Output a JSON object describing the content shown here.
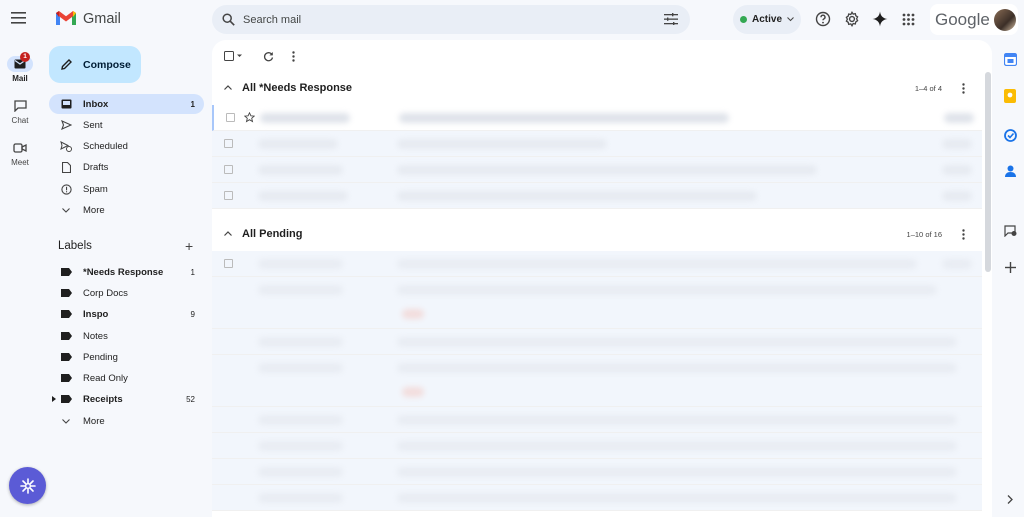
{
  "app": {
    "name": "Gmail"
  },
  "rail": {
    "items": [
      {
        "label": "Mail",
        "badge": "1"
      },
      {
        "label": "Chat"
      },
      {
        "label": "Meet"
      }
    ]
  },
  "search": {
    "placeholder": "Search mail"
  },
  "status": {
    "label": "Active",
    "color": "#34a853"
  },
  "account": {
    "brand": "Google"
  },
  "compose": {
    "label": "Compose"
  },
  "nav": {
    "items": [
      {
        "label": "Inbox",
        "count": "1"
      },
      {
        "label": "Sent",
        "count": ""
      },
      {
        "label": "Scheduled",
        "count": ""
      },
      {
        "label": "Drafts",
        "count": ""
      },
      {
        "label": "Spam",
        "count": ""
      },
      {
        "label": "More",
        "count": ""
      }
    ]
  },
  "labels": {
    "title": "Labels",
    "items": [
      {
        "label": "*Needs Response",
        "count": "1"
      },
      {
        "label": "Corp Docs",
        "count": ""
      },
      {
        "label": "Inspo",
        "count": "9"
      },
      {
        "label": "Notes",
        "count": ""
      },
      {
        "label": "Pending",
        "count": ""
      },
      {
        "label": "Read Only",
        "count": ""
      },
      {
        "label": "Receipts",
        "count": "52"
      },
      {
        "label": "More",
        "count": ""
      }
    ]
  },
  "sections": [
    {
      "title": "All *Needs Response",
      "range": "1–4 of 4"
    },
    {
      "title": "All Pending",
      "range": "1–10 of 16"
    }
  ],
  "colors": {
    "accent": "#c2e7ff",
    "selected": "#d3e3fd",
    "badge": "#c5221f",
    "fab": "#5b5bd6"
  }
}
